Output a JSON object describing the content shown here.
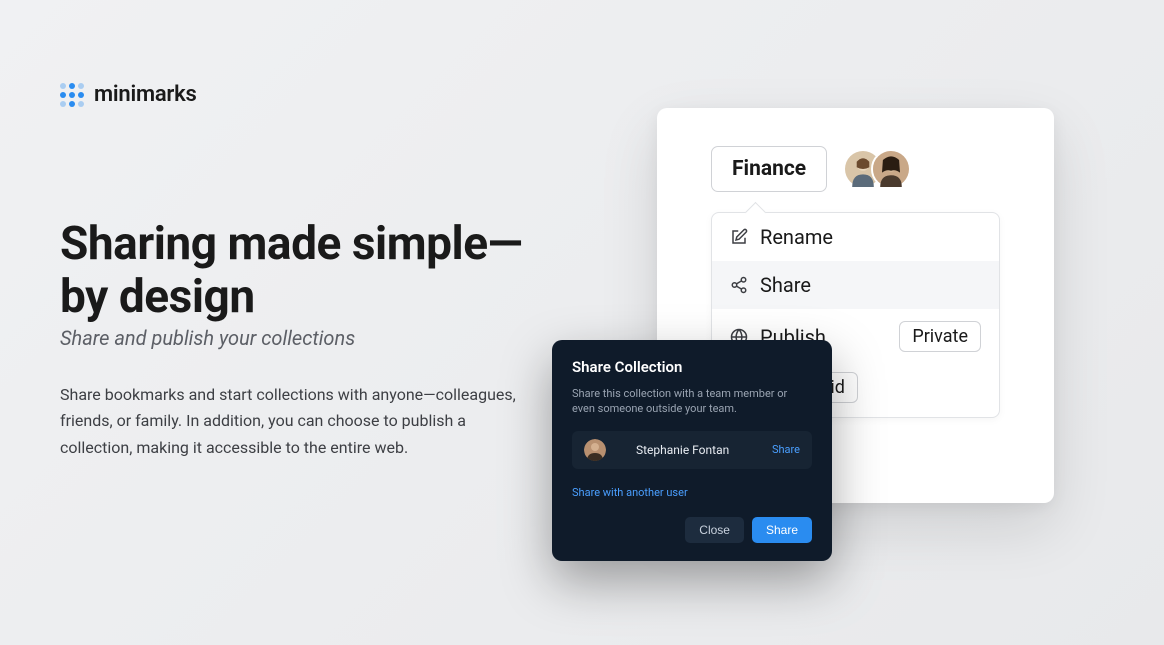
{
  "brand": {
    "name": "minimarks"
  },
  "hero": {
    "headline": "Sharing made simple—\nby design",
    "subhead": "Share and publish your collections",
    "body": "Share bookmarks and start collections with anyone—colleagues, friends, or family. In addition, you can choose to publish a collection, making it accessible to the entire web."
  },
  "collection": {
    "name": "Finance",
    "menu": {
      "rename": "Rename",
      "share": "Share",
      "publish": "Publish",
      "publish_badge": "Private",
      "layout_badge": "Icon Grid"
    }
  },
  "modal": {
    "title": "Share Collection",
    "subtitle": "Share this collection with a team member or even someone outside your team.",
    "user": {
      "name": "Stephanie Fontan",
      "action": "Share"
    },
    "another": "Share with another user",
    "close": "Close",
    "confirm": "Share"
  }
}
